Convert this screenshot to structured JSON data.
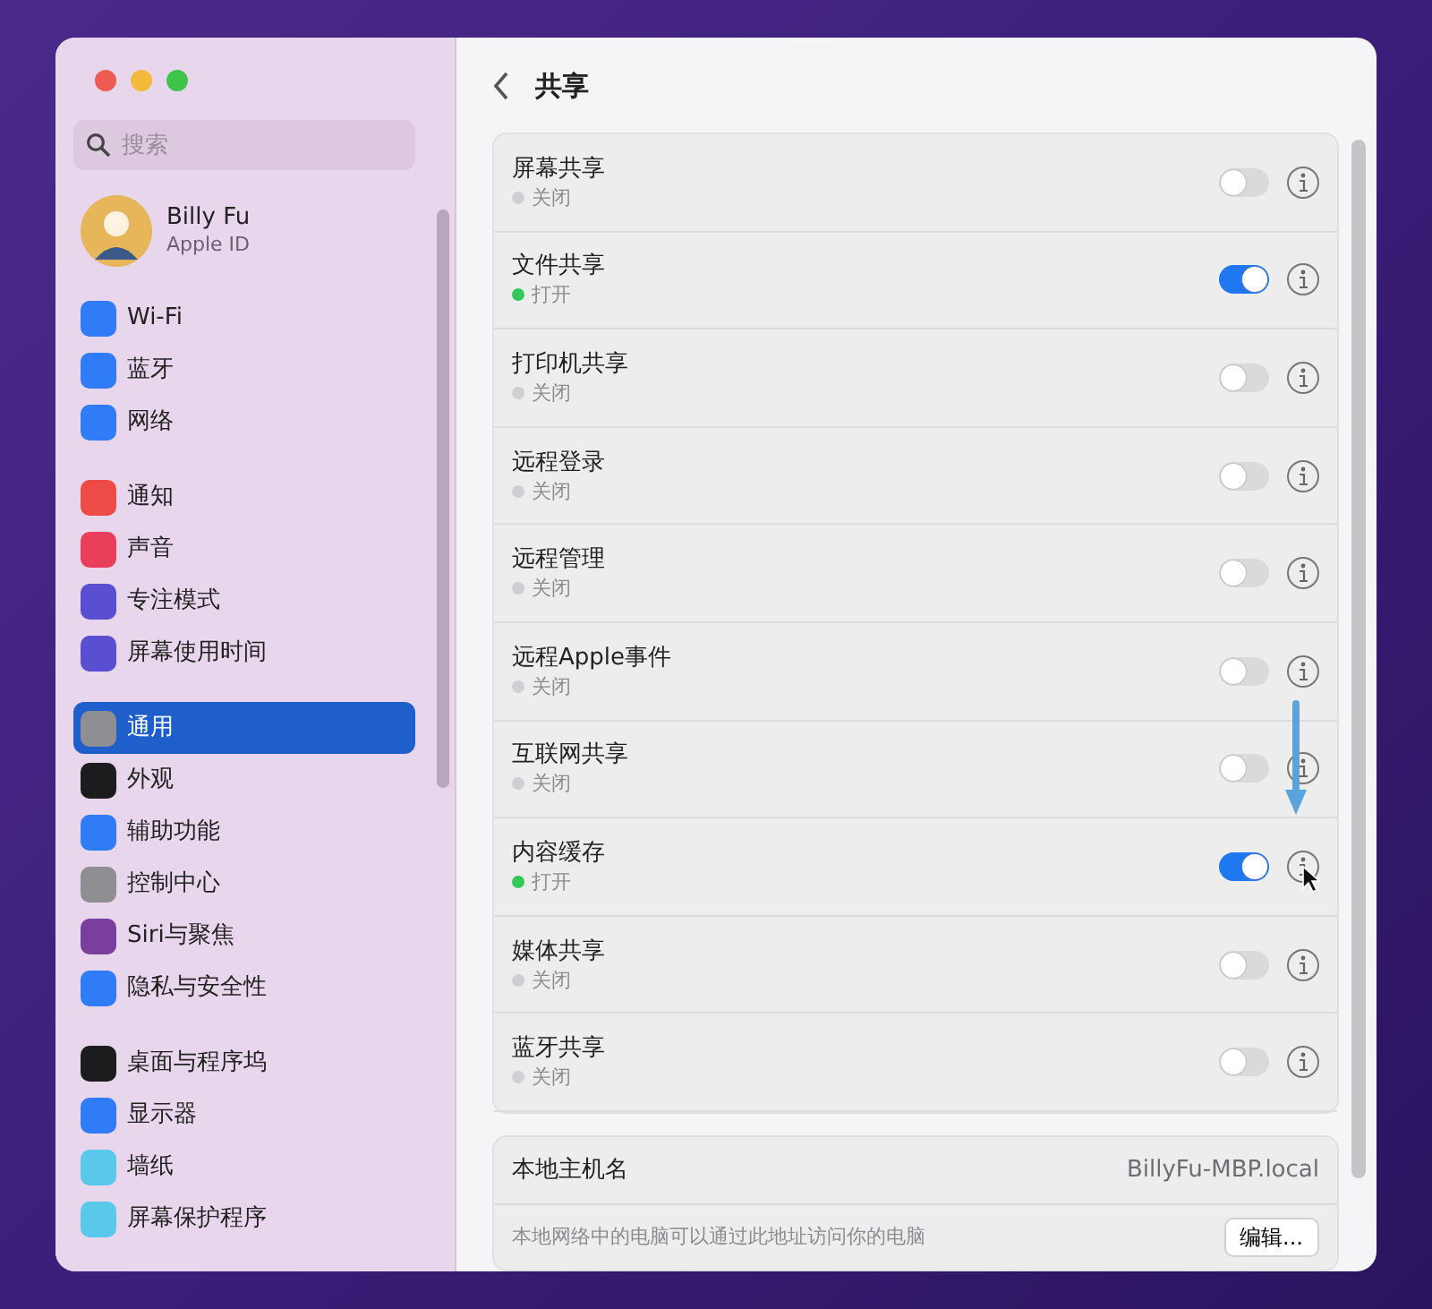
{
  "window": {
    "title": "共享"
  },
  "sidebar": {
    "search": {
      "placeholder": "搜索"
    },
    "account": {
      "name": "Billy Fu",
      "subtitle": "Apple ID"
    },
    "groups": [
      {
        "items": [
          {
            "label": "Wi-Fi",
            "color": "#2f7cf6",
            "selected": false
          },
          {
            "label": "蓝牙",
            "color": "#2f7cf6",
            "selected": false
          },
          {
            "label": "网络",
            "color": "#2f7cf6",
            "selected": false
          }
        ]
      },
      {
        "items": [
          {
            "label": "通知",
            "color": "#ec4c45",
            "selected": false
          },
          {
            "label": "声音",
            "color": "#ea3f5a",
            "selected": false
          },
          {
            "label": "专注模式",
            "color": "#5a4fd0",
            "selected": false
          },
          {
            "label": "屏幕使用时间",
            "color": "#5a4fd0",
            "selected": false
          }
        ]
      },
      {
        "items": [
          {
            "label": "通用",
            "color": "#8e8e93",
            "selected": true
          },
          {
            "label": "外观",
            "color": "#1c1c1e",
            "selected": false
          },
          {
            "label": "辅助功能",
            "color": "#2f7cf6",
            "selected": false
          },
          {
            "label": "控制中心",
            "color": "#8e8e93",
            "selected": false
          },
          {
            "label": "Siri与聚焦",
            "color": "#7a3f9e",
            "selected": false
          },
          {
            "label": "隐私与安全性",
            "color": "#2f7cf6",
            "selected": false
          }
        ]
      },
      {
        "items": [
          {
            "label": "桌面与程序坞",
            "color": "#1c1c1e",
            "selected": false
          },
          {
            "label": "显示器",
            "color": "#2f7cf6",
            "selected": false
          },
          {
            "label": "墙纸",
            "color": "#5ac8ea",
            "selected": false
          },
          {
            "label": "屏幕保护程序",
            "color": "#5ac8ea",
            "selected": false
          }
        ]
      }
    ]
  },
  "services": [
    {
      "name": "屏幕共享",
      "status": "关闭",
      "on": false
    },
    {
      "name": "文件共享",
      "status": "打开",
      "on": true
    },
    {
      "name": "打印机共享",
      "status": "关闭",
      "on": false
    },
    {
      "name": "远程登录",
      "status": "关闭",
      "on": false
    },
    {
      "name": "远程管理",
      "status": "关闭",
      "on": false
    },
    {
      "name": "远程Apple事件",
      "status": "关闭",
      "on": false
    },
    {
      "name": "互联网共享",
      "status": "关闭",
      "on": false
    },
    {
      "name": "内容缓存",
      "status": "打开",
      "on": true
    },
    {
      "name": "媒体共享",
      "status": "关闭",
      "on": false
    },
    {
      "name": "蓝牙共享",
      "status": "关闭",
      "on": false
    }
  ],
  "hostname": {
    "label": "本地主机名",
    "value": "BillyFu-MBP.local",
    "description": "本地网络中的电脑可以通过此地址访问你的电脑",
    "edit_button": "编辑..."
  }
}
